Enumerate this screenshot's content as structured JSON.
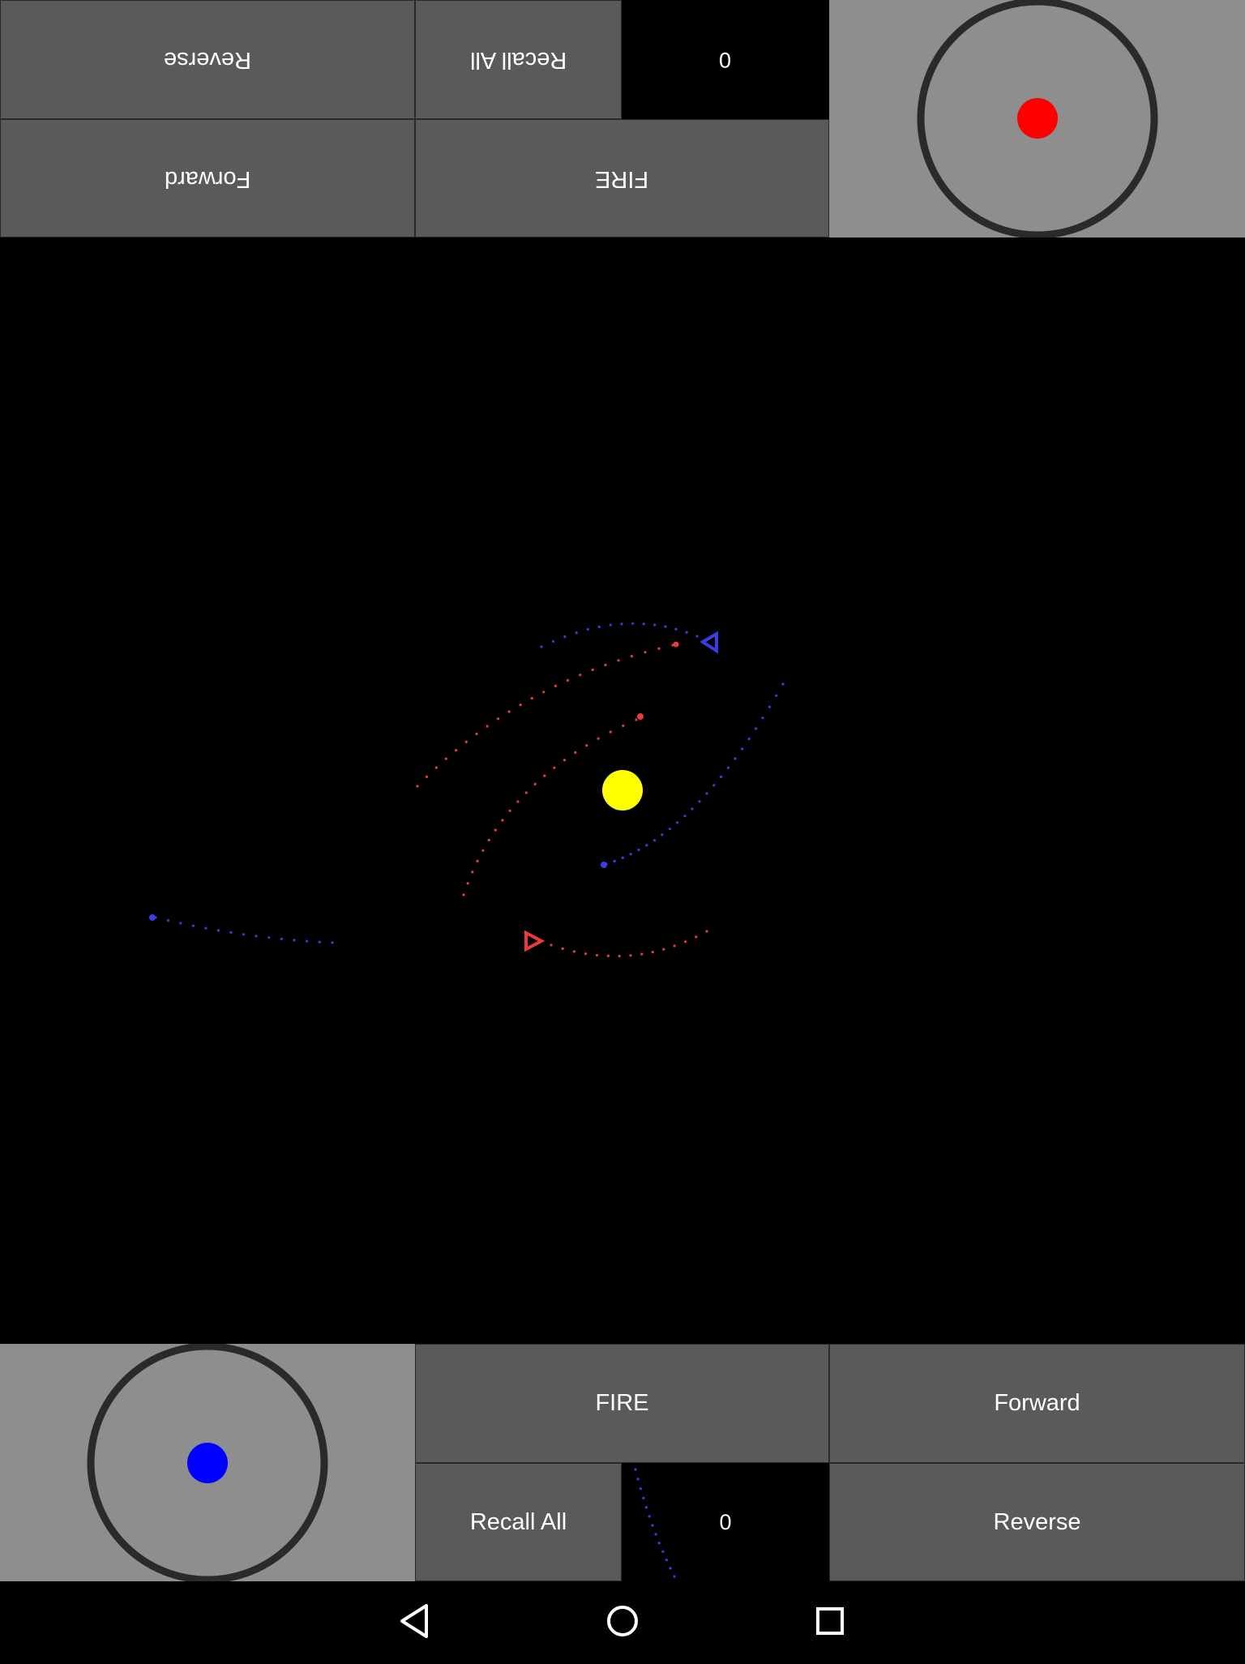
{
  "player_top": {
    "reverse_label": "Reverse",
    "recall_label": "Recall All",
    "score": "0",
    "forward_label": "Forward",
    "fire_label": "FIRE",
    "knob_color": "#ff0000"
  },
  "player_bottom": {
    "fire_label": "FIRE",
    "forward_label": "Forward",
    "recall_label": "Recall All",
    "score": "0",
    "reverse_label": "Reverse",
    "knob_color": "#0000ff"
  },
  "colors": {
    "button_bg": "#5a5a5a",
    "pad_bg": "#8e8e8e",
    "ring": "#2a2a2a",
    "sun": "#ffff00",
    "red_team": "#e83b3b",
    "blue_team": "#3b3be8"
  },
  "navigation": {
    "back_icon": "back-triangle-icon",
    "home_icon": "home-circle-icon",
    "recents_icon": "recents-square-icon"
  }
}
